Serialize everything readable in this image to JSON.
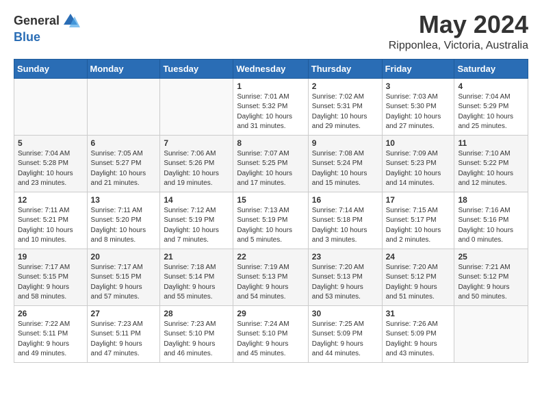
{
  "logo": {
    "general": "General",
    "blue": "Blue"
  },
  "title": "May 2024",
  "location": "Ripponlea, Victoria, Australia",
  "headers": [
    "Sunday",
    "Monday",
    "Tuesday",
    "Wednesday",
    "Thursday",
    "Friday",
    "Saturday"
  ],
  "weeks": [
    [
      {
        "day": "",
        "info": ""
      },
      {
        "day": "",
        "info": ""
      },
      {
        "day": "",
        "info": ""
      },
      {
        "day": "1",
        "info": "Sunrise: 7:01 AM\nSunset: 5:32 PM\nDaylight: 10 hours\nand 31 minutes."
      },
      {
        "day": "2",
        "info": "Sunrise: 7:02 AM\nSunset: 5:31 PM\nDaylight: 10 hours\nand 29 minutes."
      },
      {
        "day": "3",
        "info": "Sunrise: 7:03 AM\nSunset: 5:30 PM\nDaylight: 10 hours\nand 27 minutes."
      },
      {
        "day": "4",
        "info": "Sunrise: 7:04 AM\nSunset: 5:29 PM\nDaylight: 10 hours\nand 25 minutes."
      }
    ],
    [
      {
        "day": "5",
        "info": "Sunrise: 7:04 AM\nSunset: 5:28 PM\nDaylight: 10 hours\nand 23 minutes."
      },
      {
        "day": "6",
        "info": "Sunrise: 7:05 AM\nSunset: 5:27 PM\nDaylight: 10 hours\nand 21 minutes."
      },
      {
        "day": "7",
        "info": "Sunrise: 7:06 AM\nSunset: 5:26 PM\nDaylight: 10 hours\nand 19 minutes."
      },
      {
        "day": "8",
        "info": "Sunrise: 7:07 AM\nSunset: 5:25 PM\nDaylight: 10 hours\nand 17 minutes."
      },
      {
        "day": "9",
        "info": "Sunrise: 7:08 AM\nSunset: 5:24 PM\nDaylight: 10 hours\nand 15 minutes."
      },
      {
        "day": "10",
        "info": "Sunrise: 7:09 AM\nSunset: 5:23 PM\nDaylight: 10 hours\nand 14 minutes."
      },
      {
        "day": "11",
        "info": "Sunrise: 7:10 AM\nSunset: 5:22 PM\nDaylight: 10 hours\nand 12 minutes."
      }
    ],
    [
      {
        "day": "12",
        "info": "Sunrise: 7:11 AM\nSunset: 5:21 PM\nDaylight: 10 hours\nand 10 minutes."
      },
      {
        "day": "13",
        "info": "Sunrise: 7:11 AM\nSunset: 5:20 PM\nDaylight: 10 hours\nand 8 minutes."
      },
      {
        "day": "14",
        "info": "Sunrise: 7:12 AM\nSunset: 5:19 PM\nDaylight: 10 hours\nand 7 minutes."
      },
      {
        "day": "15",
        "info": "Sunrise: 7:13 AM\nSunset: 5:19 PM\nDaylight: 10 hours\nand 5 minutes."
      },
      {
        "day": "16",
        "info": "Sunrise: 7:14 AM\nSunset: 5:18 PM\nDaylight: 10 hours\nand 3 minutes."
      },
      {
        "day": "17",
        "info": "Sunrise: 7:15 AM\nSunset: 5:17 PM\nDaylight: 10 hours\nand 2 minutes."
      },
      {
        "day": "18",
        "info": "Sunrise: 7:16 AM\nSunset: 5:16 PM\nDaylight: 10 hours\nand 0 minutes."
      }
    ],
    [
      {
        "day": "19",
        "info": "Sunrise: 7:17 AM\nSunset: 5:15 PM\nDaylight: 9 hours\nand 58 minutes."
      },
      {
        "day": "20",
        "info": "Sunrise: 7:17 AM\nSunset: 5:15 PM\nDaylight: 9 hours\nand 57 minutes."
      },
      {
        "day": "21",
        "info": "Sunrise: 7:18 AM\nSunset: 5:14 PM\nDaylight: 9 hours\nand 55 minutes."
      },
      {
        "day": "22",
        "info": "Sunrise: 7:19 AM\nSunset: 5:13 PM\nDaylight: 9 hours\nand 54 minutes."
      },
      {
        "day": "23",
        "info": "Sunrise: 7:20 AM\nSunset: 5:13 PM\nDaylight: 9 hours\nand 53 minutes."
      },
      {
        "day": "24",
        "info": "Sunrise: 7:20 AM\nSunset: 5:12 PM\nDaylight: 9 hours\nand 51 minutes."
      },
      {
        "day": "25",
        "info": "Sunrise: 7:21 AM\nSunset: 5:12 PM\nDaylight: 9 hours\nand 50 minutes."
      }
    ],
    [
      {
        "day": "26",
        "info": "Sunrise: 7:22 AM\nSunset: 5:11 PM\nDaylight: 9 hours\nand 49 minutes."
      },
      {
        "day": "27",
        "info": "Sunrise: 7:23 AM\nSunset: 5:11 PM\nDaylight: 9 hours\nand 47 minutes."
      },
      {
        "day": "28",
        "info": "Sunrise: 7:23 AM\nSunset: 5:10 PM\nDaylight: 9 hours\nand 46 minutes."
      },
      {
        "day": "29",
        "info": "Sunrise: 7:24 AM\nSunset: 5:10 PM\nDaylight: 9 hours\nand 45 minutes."
      },
      {
        "day": "30",
        "info": "Sunrise: 7:25 AM\nSunset: 5:09 PM\nDaylight: 9 hours\nand 44 minutes."
      },
      {
        "day": "31",
        "info": "Sunrise: 7:26 AM\nSunset: 5:09 PM\nDaylight: 9 hours\nand 43 minutes."
      },
      {
        "day": "",
        "info": ""
      }
    ]
  ]
}
